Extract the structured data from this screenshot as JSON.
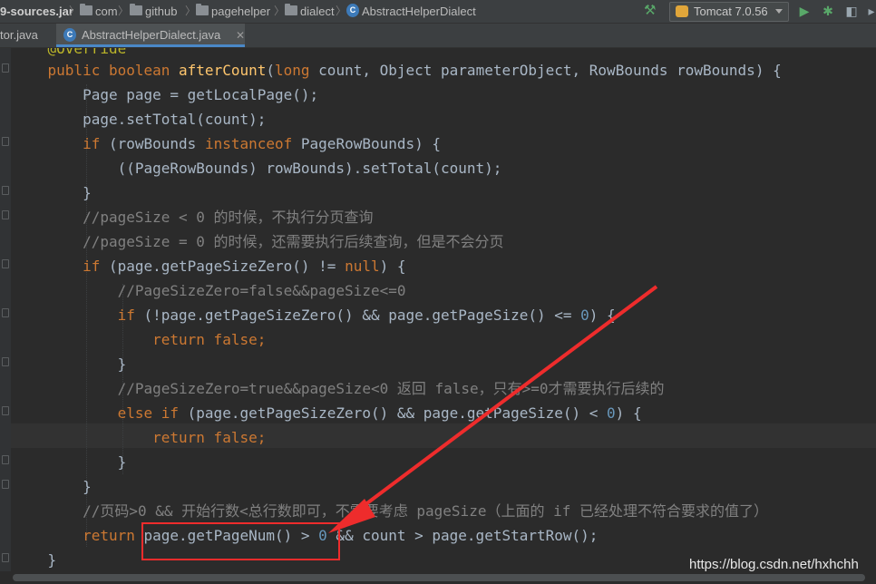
{
  "breadcrumb": {
    "jar": "9-sources.jar",
    "items": [
      "com",
      "github",
      "pagehelper",
      "dialect"
    ],
    "class_name": "AbstractHelperDialect"
  },
  "toolbar": {
    "run_config": "Tomcat 7.0.56"
  },
  "tabs": {
    "first": "tor.java",
    "active": "AbstractHelperDialect.java"
  },
  "code": {
    "l0": "    @Override",
    "l1": {
      "a": "public ",
      "b": "boolean ",
      "c": "afterCount",
      "d": "(",
      "e": "long ",
      "f": "count, Object parameterObject, RowBounds rowBounds) {"
    },
    "l2": "        Page page = getLocalPage();",
    "l3": "        page.setTotal(count);",
    "l4": {
      "a": "if ",
      "b": "(rowBounds ",
      "c": "instanceof ",
      "d": "PageRowBounds) {"
    },
    "l5": "            ((PageRowBounds) rowBounds).setTotal(count);",
    "l6": "        }",
    "l7": "        //pageSize < 0 的时候，不执行分页查询",
    "l8": "        //pageSize = 0 的时候，还需要执行后续查询，但是不会分页",
    "l9": {
      "a": "if ",
      "b": "(page.getPageSizeZero() != ",
      "c": "null",
      "d": ") {"
    },
    "l10": "            //PageSizeZero=false&&pageSize<=0",
    "l11": {
      "a": "if ",
      "b": "(!page.getPageSizeZero() && page.getPageSize() <= ",
      "c": "0",
      "d": ") {"
    },
    "l12": {
      "a": "return false",
      "b": ";"
    },
    "l13": "            }",
    "l14": "            //PageSizeZero=true&&pageSize<0 返回 false，只有>=0才需要执行后续的",
    "l15": {
      "a": "else if ",
      "b": "(page.getPageSizeZero() && page.getPageSize() < ",
      "c": "0",
      "d": ") {"
    },
    "l16": {
      "a": "return false",
      "b": ";"
    },
    "l17": "            }",
    "l18": "        }",
    "l19": "        //页码>0 && 开始行数<总行数即可，不需要考虑 pageSize（上面的 if 已经处理不符合要求的值了）",
    "l20": {
      "a": "return ",
      "b": "page.getPageNum() > ",
      "c": "0",
      "d": " && count > page.getStartRow();"
    },
    "l21": "    }"
  },
  "watermark": "https://blog.csdn.net/hxhchh"
}
